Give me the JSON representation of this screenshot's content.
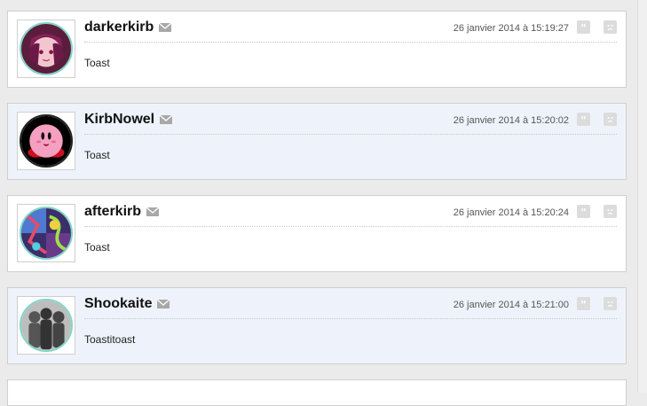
{
  "posts": [
    {
      "username": "darkerkirb",
      "date": "26 janvier 2014 à 15:19:27",
      "content": "Toast"
    },
    {
      "username": "KirbNowel",
      "date": "26 janvier 2014 à 15:20:02",
      "content": "Toast"
    },
    {
      "username": "afterkirb",
      "date": "26 janvier 2014 à 15:20:24",
      "content": "Toast"
    },
    {
      "username": "Shookaite",
      "date": "26 janvier 2014 à 15:21:00",
      "content": "Toastitoast"
    }
  ],
  "icons": {
    "mail": "envelope-icon",
    "quote": "quote-icon",
    "report": "report-face-icon"
  },
  "colors": {
    "page_bg": "#ebebeb",
    "post_bg": "#ffffff",
    "post_alt_bg": "#eef3fb",
    "avatar_ring": "#7fd6c8",
    "icon_grey": "#a8a8a8"
  }
}
